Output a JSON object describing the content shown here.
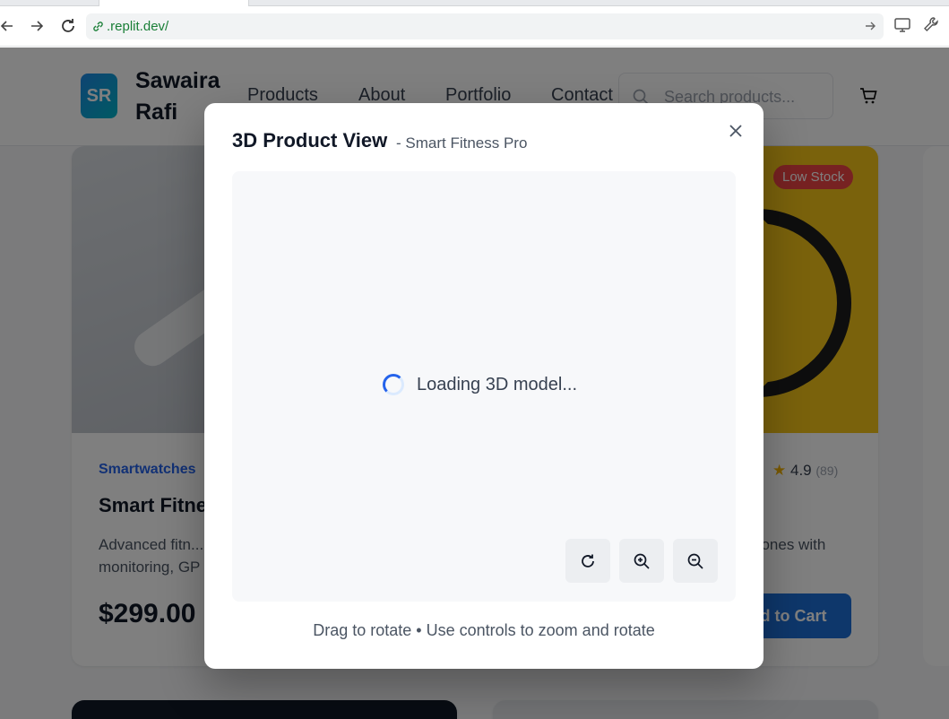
{
  "browser": {
    "url": ".replit.dev/"
  },
  "site": {
    "logo_text": "SR",
    "brand_name": "Sawaira Rafi",
    "nav": [
      "Products",
      "About",
      "Portfolio",
      "Contact"
    ],
    "search_placeholder": "Search products..."
  },
  "products": [
    {
      "category": "Smartwatches",
      "title": "Smart Fitne",
      "description": "Advanced fitn... monitoring, GP",
      "price": "$299.00"
    },
    {
      "badge": "Low Stock",
      "rating": "4.9",
      "review_count": "(89)",
      "description_fragment": "hones with",
      "add_to_cart": "dd to Cart"
    }
  ],
  "modal": {
    "title": "3D Product View",
    "subtitle": "- Smart Fitness Pro",
    "loading_text": "Loading 3D model...",
    "controls": [
      {
        "name": "rotate",
        "icon": "rotate-icon"
      },
      {
        "name": "zoom-in",
        "icon": "zoom-in-icon"
      },
      {
        "name": "zoom-out",
        "icon": "zoom-out-icon"
      }
    ],
    "hint": "Drag to rotate • Use controls to zoom and rotate",
    "close_icon": "close-icon"
  },
  "colors": {
    "accent": "#2563eb",
    "badge": "#ef4444",
    "overlay": "rgba(0,0,0,0.5)"
  }
}
